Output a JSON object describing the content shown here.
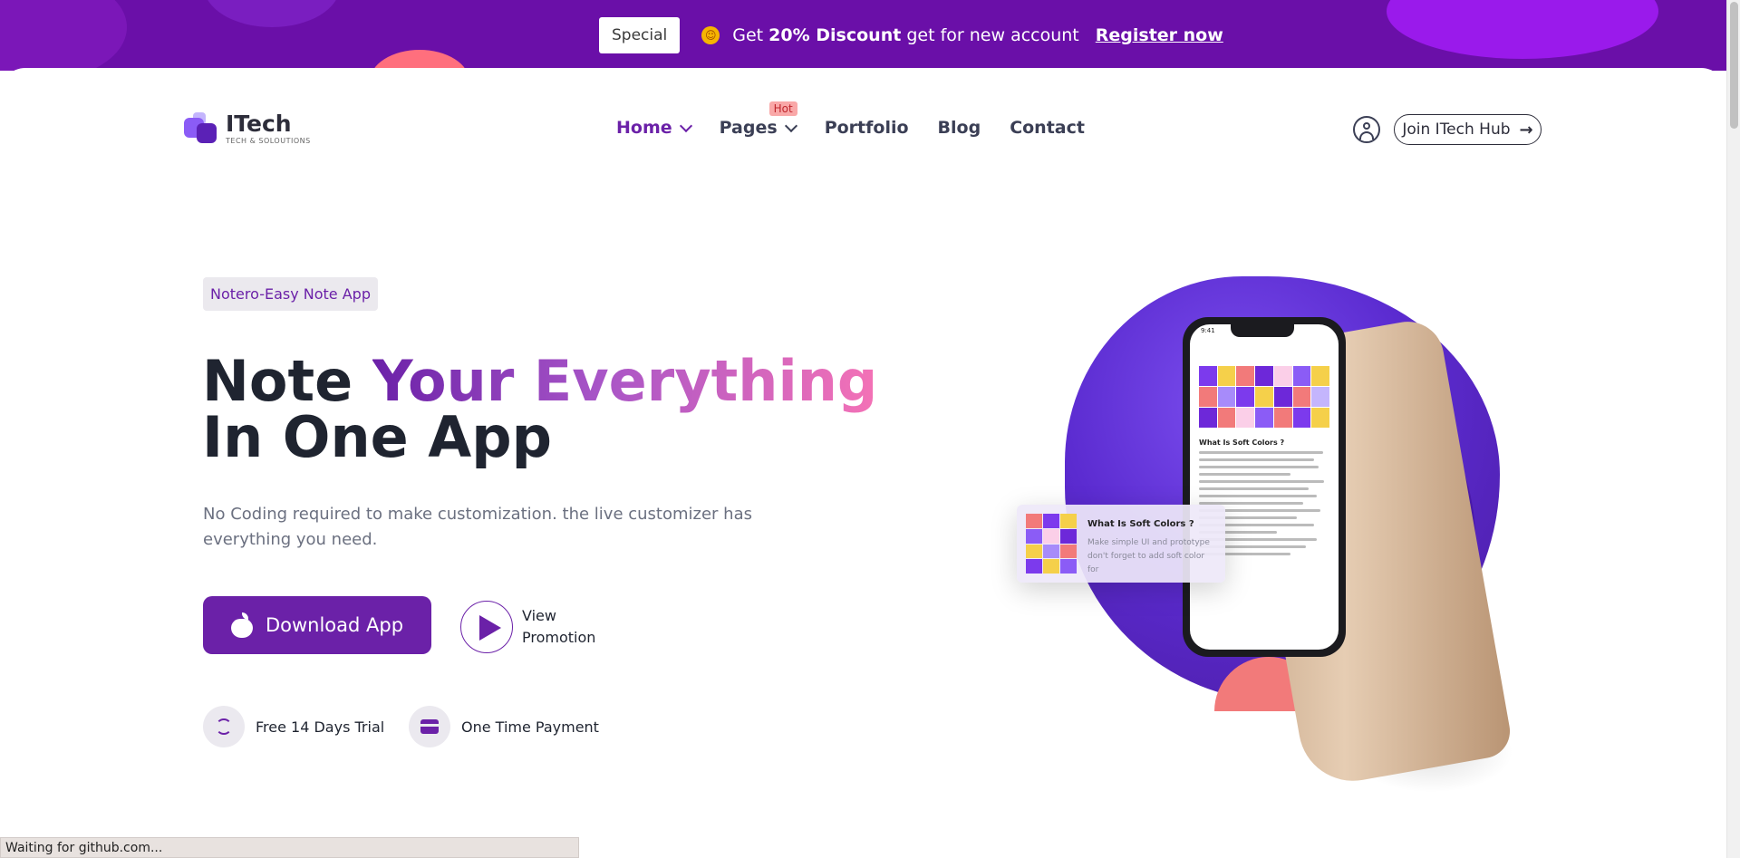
{
  "promo": {
    "special_label": "Special",
    "text_prefix": "Get ",
    "text_bold": "20% Discount",
    "text_suffix": " get for new account",
    "register_label": "Register now"
  },
  "logo": {
    "name": "ITech",
    "tagline": "TECH & SOLOUTIONS"
  },
  "nav": {
    "items": [
      {
        "label": "Home",
        "has_dropdown": true,
        "active": true
      },
      {
        "label": "Pages",
        "has_dropdown": true,
        "badge": "Hot"
      },
      {
        "label": "Portfolio"
      },
      {
        "label": "Blog"
      },
      {
        "label": "Contact"
      }
    ],
    "join_label": "Join ITech Hub"
  },
  "hero": {
    "tag": "Notero-Easy Note App",
    "title_part1": "Note ",
    "title_highlight": "Your Everything",
    "title_line2": "In One App",
    "description": "No Coding required to make customization. the live customizer has everything you need.",
    "download_label": "Download App",
    "promotion_label": "View Promotion",
    "features": [
      {
        "label": "Free 14 Days Trial",
        "icon": "refresh-icon"
      },
      {
        "label": "One Time Payment",
        "icon": "credit-card-icon"
      }
    ]
  },
  "illustration": {
    "phone_time": "9:41",
    "phone_heading": "What Is Soft Colors ?",
    "card_title": "What Is Soft Colors ?",
    "card_desc": "Make simple UI and prototype don't forget to add soft color for"
  },
  "colors": {
    "accent": "#6b21a8",
    "promo_bg": "#6a0fa8",
    "blob": "#5b2bd0"
  },
  "status_bar": "Waiting for github.com..."
}
